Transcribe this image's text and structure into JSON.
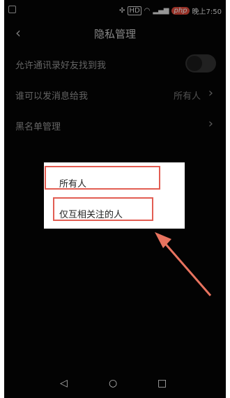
{
  "status_bar": {
    "hd_label": "HD",
    "time": "晚上7:50",
    "watermark": "php"
  },
  "header": {
    "title": "隐私管理"
  },
  "settings": {
    "items": [
      {
        "label": "允许通讯录好友找到我",
        "toggle_on": false
      },
      {
        "label": "谁可以发消息给我",
        "value": "所有人"
      },
      {
        "label": "黑名单管理"
      }
    ]
  },
  "popup": {
    "options": [
      "所有人",
      "仅互相关注的人"
    ]
  },
  "colors": {
    "background": "#050505",
    "highlight": "#e25d52",
    "popup": "#ffffff"
  },
  "navigation": {
    "back_icon": "triangle-back-icon",
    "home_icon": "circle-home-icon",
    "recents_icon": "square-recents-icon"
  }
}
